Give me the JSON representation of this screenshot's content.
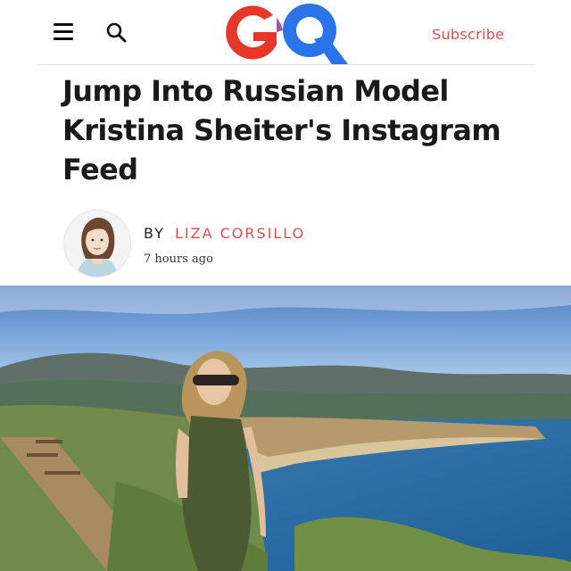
{
  "header": {
    "logo_text": "GQ",
    "subscribe_label": "Subscribe"
  },
  "article": {
    "headline": "Jump Into Russian Model Kristina Sheiter's Instagram Feed",
    "byline_prefix": "BY",
    "author": "LIZA CORSILLO",
    "timestamp": "7 hours ago"
  },
  "colors": {
    "accent": "#d9534f",
    "logo_red": "#e8362b",
    "logo_blue": "#2a73e8"
  },
  "icons": [
    "menu-icon",
    "search-icon"
  ]
}
